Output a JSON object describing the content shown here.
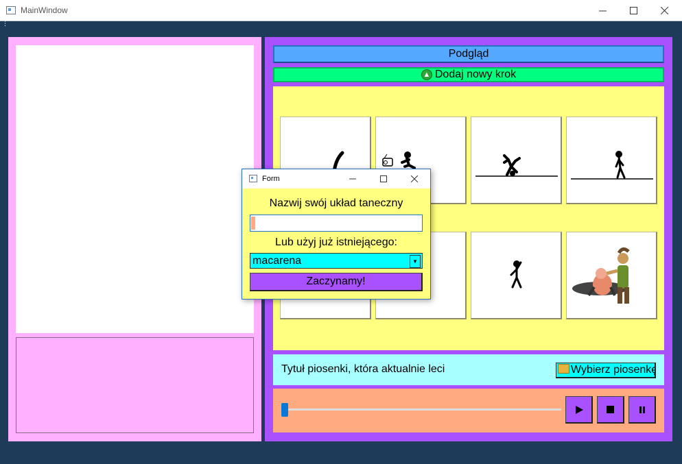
{
  "window": {
    "title": "MainWindow",
    "icon": "app-window-icon"
  },
  "right_panel": {
    "preview_label": "Podgląd",
    "add_step_label": "Dodaj nowy krok",
    "song_title": "Tytuł piosenki, która aktualnie leci",
    "choose_song_label": "Wybierz piosenkę",
    "player": {
      "progress": 0,
      "play_icon": "play-icon",
      "stop_icon": "stop-icon",
      "pause_icon": "pause-icon"
    }
  },
  "dialog": {
    "title": "Form",
    "prompt_name": "Nazwij swój układ taneczny",
    "name_value": "",
    "prompt_existing": "Lub użyj już istniejącego:",
    "selected_choreography": "macarena",
    "start_label": "Zaczynamy!"
  },
  "colors": {
    "left_panel": "#ffb0ff",
    "right_panel": "#a950ff",
    "preview_button": "#55a8ff",
    "add_step_button": "#00ff80",
    "grid_background": "#ffff80",
    "song_bar": "#a8ffff",
    "player_bar": "#ffaa80",
    "window_background": "#1f3b5a"
  }
}
